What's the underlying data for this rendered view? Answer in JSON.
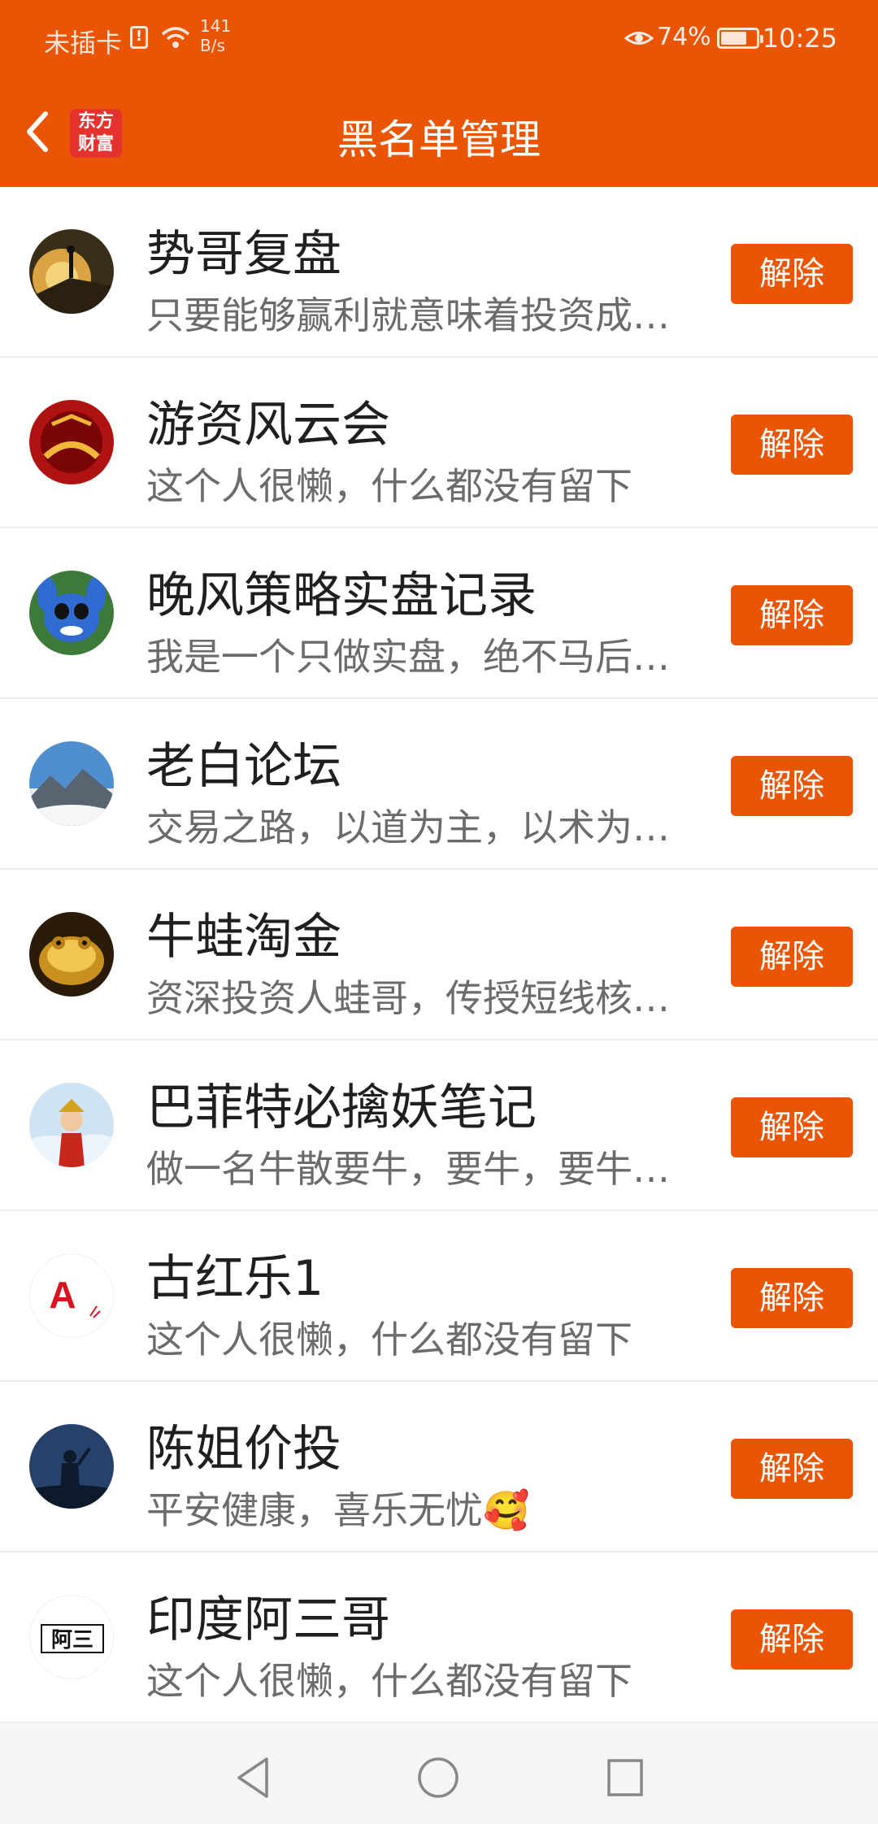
{
  "status_bar": {
    "carrier": "未插卡",
    "sim_alert": "!",
    "speed_value": "141",
    "speed_unit": "B/s",
    "battery_pct": "74%",
    "battery_level": 0.74,
    "time": "10:25"
  },
  "header": {
    "title": "黑名单管理",
    "logo_line1": "东方",
    "logo_line2": "财富"
  },
  "rows": [
    {
      "name": "势哥复盘",
      "bio": "只要能够赢利就意味着投资成…",
      "button": "解除"
    },
    {
      "name": "游资风云会",
      "bio": "这个人很懒，什么都没有留下",
      "button": "解除"
    },
    {
      "name": "晚风策略实盘记录",
      "bio": "我是一个只做实盘，绝不马后…",
      "button": "解除"
    },
    {
      "name": "老白论坛",
      "bio": "交易之路，以道为主，以术为…",
      "button": "解除"
    },
    {
      "name": "牛蛙淘金",
      "bio": "资深投资人蛙哥，传授短线核…",
      "button": "解除"
    },
    {
      "name": "巴菲特必擒妖笔记",
      "bio": "做一名牛散要牛，要牛，要牛…",
      "button": "解除"
    },
    {
      "name": "古红乐1",
      "bio": "这个人很懒，什么都没有留下",
      "button": "解除"
    },
    {
      "name": "陈姐价投",
      "bio": "平安健康，喜乐无忧🥰",
      "button": "解除"
    },
    {
      "name": "印度阿三哥",
      "bio": "这个人很懒，什么都没有留下",
      "button": "解除"
    }
  ],
  "avatars": {
    "row7_letter": "A",
    "row9_text": "阿三"
  },
  "colors": {
    "brand": "#ea5504",
    "logo_red": "#e5322d"
  }
}
